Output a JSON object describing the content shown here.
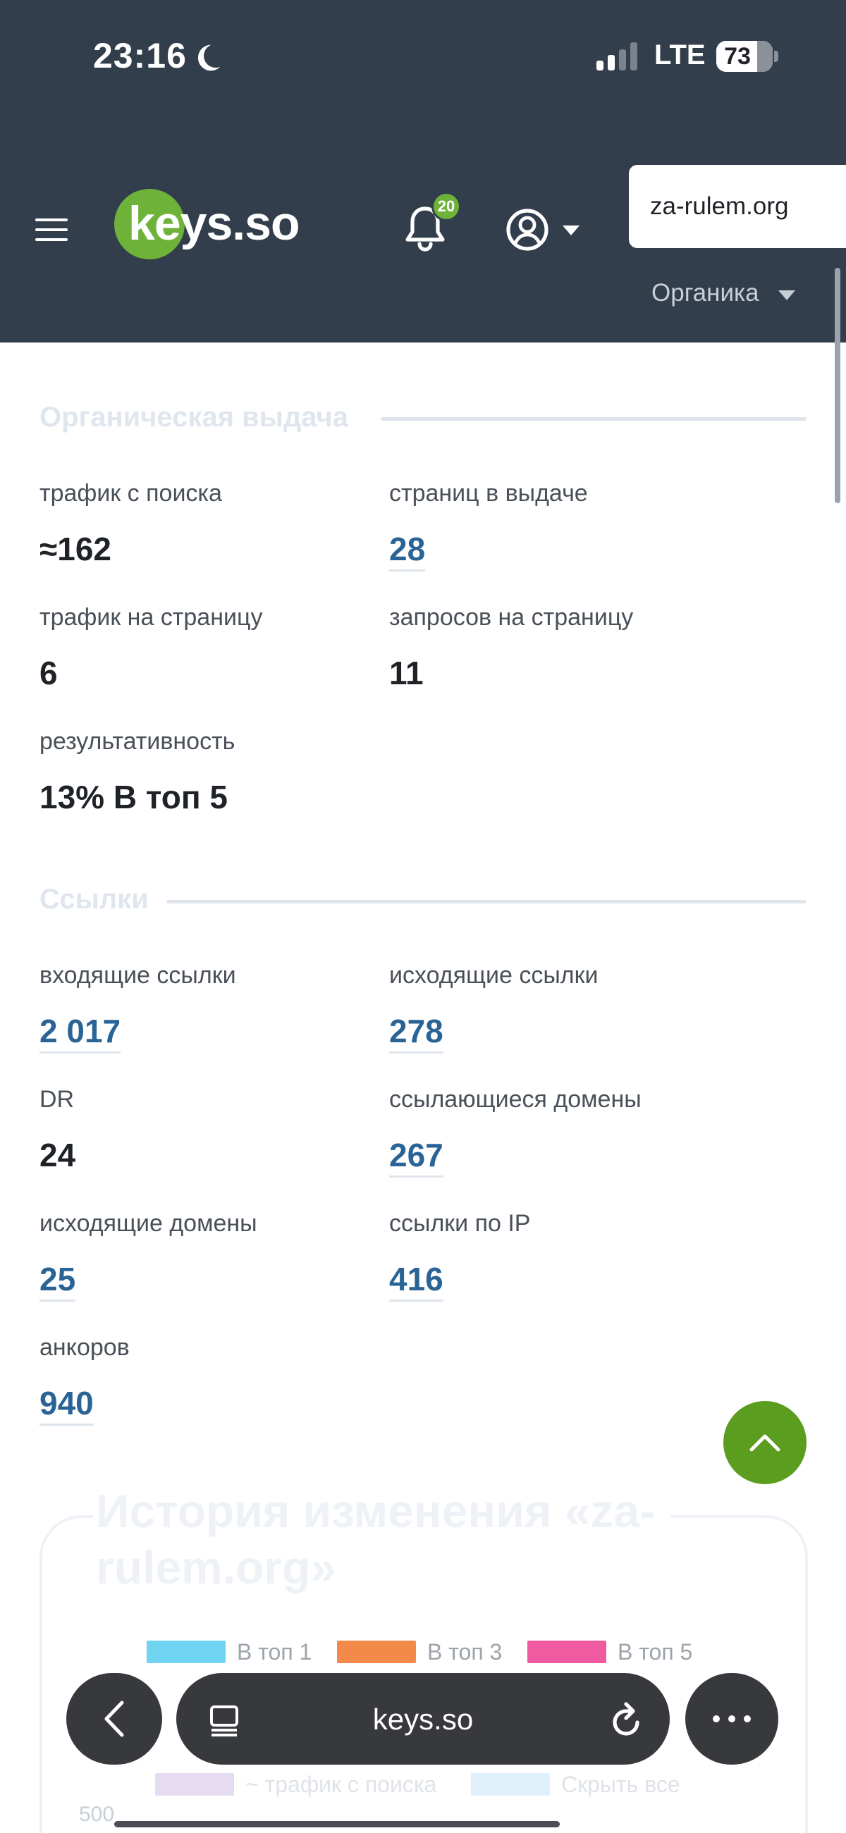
{
  "status_bar": {
    "time": "23:16",
    "network": "LTE",
    "battery": "73",
    "battery_percent": 73
  },
  "header": {
    "logo_text": "keys.so",
    "notifications_count": "20",
    "domain_value": "za-rulem.org",
    "mode_label": "Органика",
    "colors": {
      "background": "#323e4b",
      "accent": "#6fb23a"
    }
  },
  "organic": {
    "title": "Органическая выдача",
    "metrics": [
      {
        "label": "трафик с поиска",
        "value": "≈162",
        "link": false
      },
      {
        "label": "страниц в выдаче",
        "value": "28",
        "link": true
      },
      {
        "label": "трафик на страницу",
        "value": "6",
        "link": false
      },
      {
        "label": "запросов на страницу",
        "value": "11",
        "link": false
      },
      {
        "label": "результативность",
        "value": "13% В топ 5",
        "link": false
      }
    ]
  },
  "links": {
    "title": "Ссылки",
    "metrics": [
      {
        "label": "входящие ссылки",
        "value": "2 017",
        "link": true
      },
      {
        "label": "исходящие ссылки",
        "value": "278",
        "link": true
      },
      {
        "label": "DR",
        "value": "24",
        "link": false
      },
      {
        "label": "ссылающиеся домены",
        "value": "267",
        "link": true
      },
      {
        "label": "исходящие домены",
        "value": "25",
        "link": true
      },
      {
        "label": "ссылки по IP",
        "value": "416",
        "link": true
      },
      {
        "label": "анкоров",
        "value": "940",
        "link": true
      }
    ]
  },
  "history": {
    "title": "История изменения «za-rulem.org»",
    "legend": [
      {
        "label": "В топ 1",
        "color": "#6fd3f2"
      },
      {
        "label": "В топ 3",
        "color": "#f48a4a"
      },
      {
        "label": "В топ 5",
        "color": "#f05aa0"
      },
      {
        "label": "~ трафик с поиска",
        "color": "#e6dcf2"
      },
      {
        "label": "Скрыть все",
        "color": "#dff0fa"
      }
    ],
    "axis_tick": "500"
  },
  "browser": {
    "url": "keys.so"
  }
}
